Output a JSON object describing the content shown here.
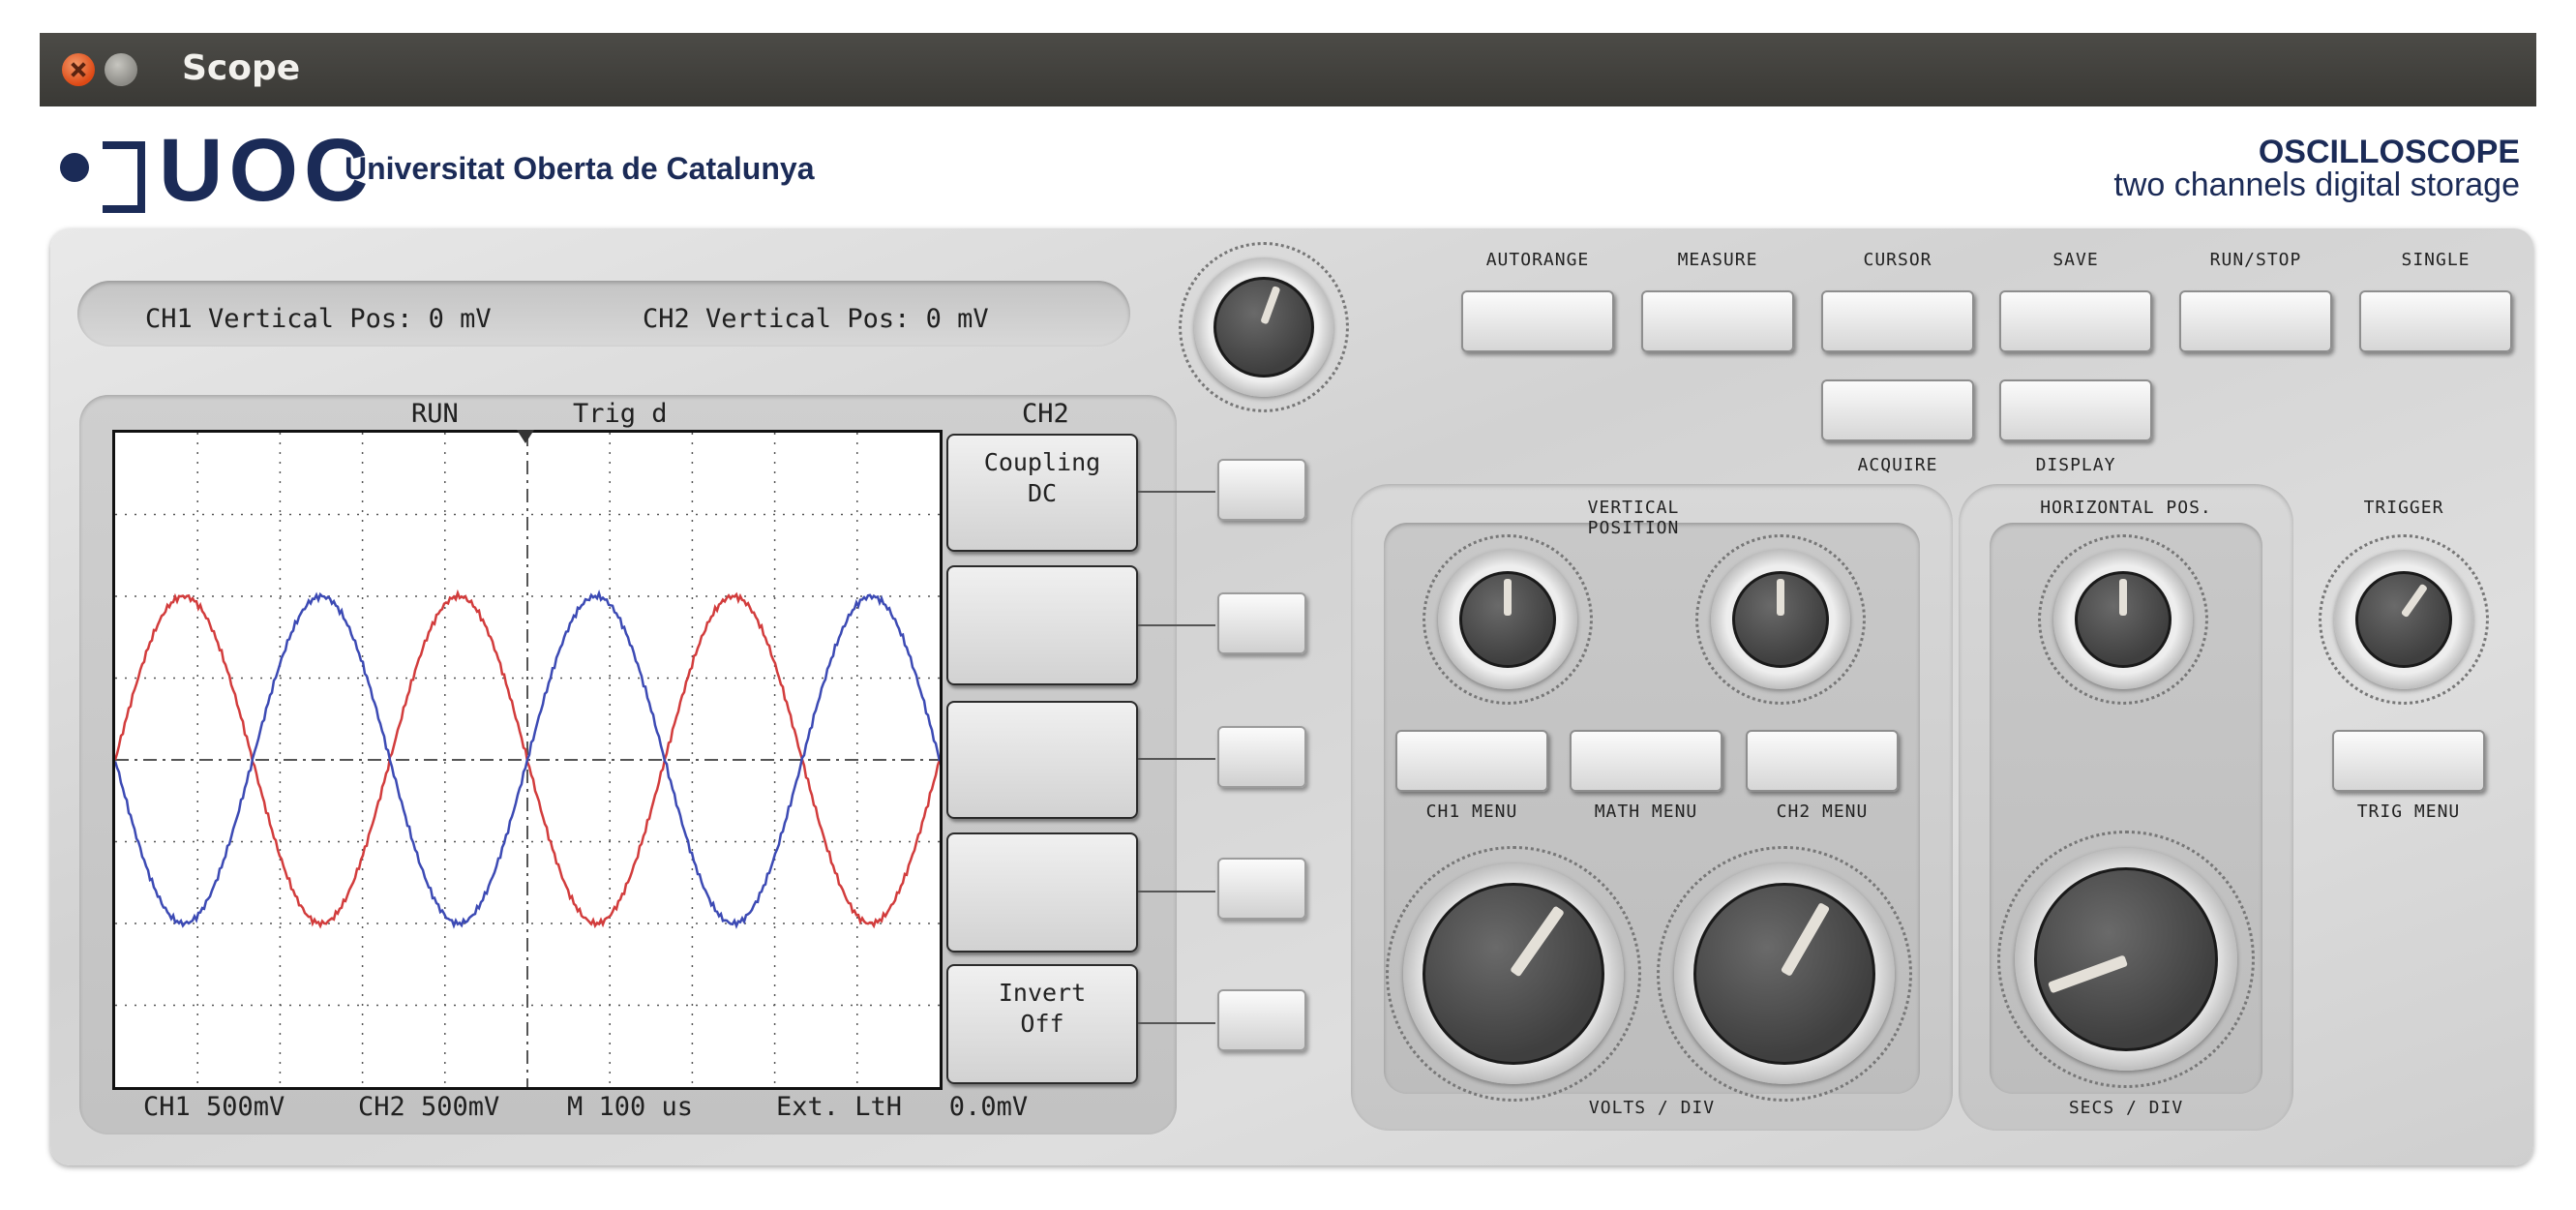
{
  "window": {
    "title": "Scope"
  },
  "header": {
    "logo": "UOC",
    "org_name": "Universitat Oberta de Catalunya",
    "app_title": "OSCILLOSCOPE",
    "app_subtitle": "two channels digital storage"
  },
  "status": {
    "ch1_pos": "CH1 Vertical Pos: 0 mV",
    "ch2_pos": "CH2 Vertical Pos: 0 mV"
  },
  "screen": {
    "run_state": "RUN",
    "trig_state": "Trig d",
    "channel": "CH2",
    "footer": {
      "ch1_scale": "CH1 500mV",
      "ch2_scale": "CH2 500mV",
      "timebase": "M 100 us",
      "trigger": "Ext. LtH   0.0mV"
    },
    "traces": [
      {
        "color": "#d23c3c",
        "amplitude_div": 2,
        "periods": 3,
        "phase": "positive"
      },
      {
        "color": "#3c4ab4",
        "amplitude_div": 2,
        "periods": 3,
        "phase": "negative"
      }
    ]
  },
  "softkeys": [
    {
      "line1": "Coupling",
      "line2": "DC"
    },
    {
      "line1": "",
      "line2": ""
    },
    {
      "line1": "",
      "line2": ""
    },
    {
      "line1": "",
      "line2": ""
    },
    {
      "line1": "Invert",
      "line2": "Off"
    }
  ],
  "buttons": {
    "autorange": "AUTORANGE",
    "measure": "MEASURE",
    "cursor": "CURSOR",
    "save": "SAVE",
    "run_stop": "RUN/STOP",
    "single": "SINGLE",
    "acquire": "ACQUIRE",
    "display": "DISPLAY",
    "ch1_menu": "CH1 MENU",
    "math_menu": "MATH MENU",
    "ch2_menu": "CH2 MENU",
    "trig_menu": "TRIG MENU"
  },
  "groups": {
    "vertical_position": "VERTICAL POSITION",
    "horizontal_pos": "HORIZONTAL POS.",
    "trigger": "TRIGGER",
    "volts_div": "VOLTS / DIV",
    "secs_div": "SECS / DIV"
  },
  "colors": {
    "panel": "#d8d8d8",
    "navy": "#1b2b57",
    "titlebar": "#3f3e3a"
  }
}
